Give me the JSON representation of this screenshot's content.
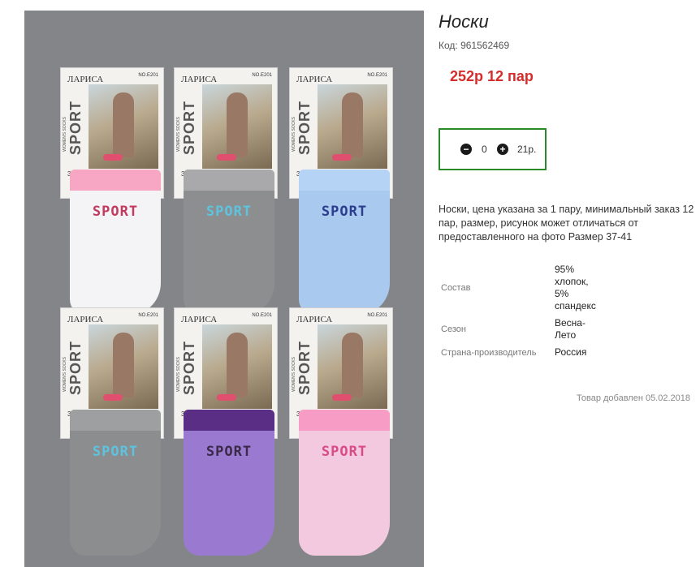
{
  "product": {
    "title": "Носки",
    "code_label": "Код: 961562469",
    "price_text": "252р  12 пар",
    "quantity": {
      "minus_icon": "minus-circle-icon",
      "value": "0",
      "plus_icon": "plus-circle-icon",
      "price": "21р."
    },
    "description": "Носки, цена указана за 1 пару, минимальный заказ 12 пар, размер, рисунок может отличаться от предоставленного на фото Размер 37-41",
    "properties": [
      {
        "key": "Состав",
        "value": "95% хлопок, 5% спандекс"
      },
      {
        "key": "Сезон",
        "value": "Весна-Лето"
      },
      {
        "key": "Страна-производитель",
        "value": "Россия"
      }
    ],
    "added_text": "Товар добавлен 05.02.2018"
  },
  "photo": {
    "socks": [
      {
        "brand": "ЛАРИСА",
        "model": "NO.E201",
        "size": "37-41",
        "card_sport": "SPORT",
        "card_sub": "WOMEN'S SOCKS",
        "word": "SPORT",
        "color": "#f4f4f6",
        "cuff": "#f7a6c4",
        "word_color": "#c43a5e"
      },
      {
        "brand": "ЛАРИСА",
        "model": "NO.E201",
        "size": "37-41",
        "card_sport": "SPORT",
        "card_sub": "WOMEN'S SOCKS",
        "word": "SPORT",
        "color": "#8d8e90",
        "cuff": "#a9a9ab",
        "word_color": "#5ec3df"
      },
      {
        "brand": "ЛАРИСА",
        "model": "NO.E201",
        "size": "37-41",
        "card_sport": "SPORT",
        "card_sub": "WOMEN'S SOCKS",
        "word": "SPORT",
        "color": "#a9c9ef",
        "cuff": "#b5d3f4",
        "word_color": "#2d3d8e"
      },
      {
        "brand": "ЛАРИСА",
        "model": "NO.E201",
        "size": "37-41",
        "card_sport": "SPORT",
        "card_sub": "WOMEN'S SOCKS",
        "word": "SPORT",
        "color": "#8c8d8f",
        "cuff": "#9e9fa1",
        "word_color": "#5ec3df"
      },
      {
        "brand": "ЛАРИСА",
        "model": "NO.E201",
        "size": "37-41",
        "card_sport": "SPORT",
        "card_sub": "WOMEN'S SOCKS",
        "word": "SPORT",
        "color": "#9a7ad0",
        "cuff": "#5b2e86",
        "word_color": "#3a2a48"
      },
      {
        "brand": "ЛАРИСА",
        "model": "NO.E201",
        "size": "37-41",
        "card_sport": "SPORT",
        "card_sub": "WOMEN'S SOCKS",
        "word": "SPORT",
        "color": "#f3c9e0",
        "cuff": "#f79cc5",
        "word_color": "#d84b86"
      }
    ]
  }
}
